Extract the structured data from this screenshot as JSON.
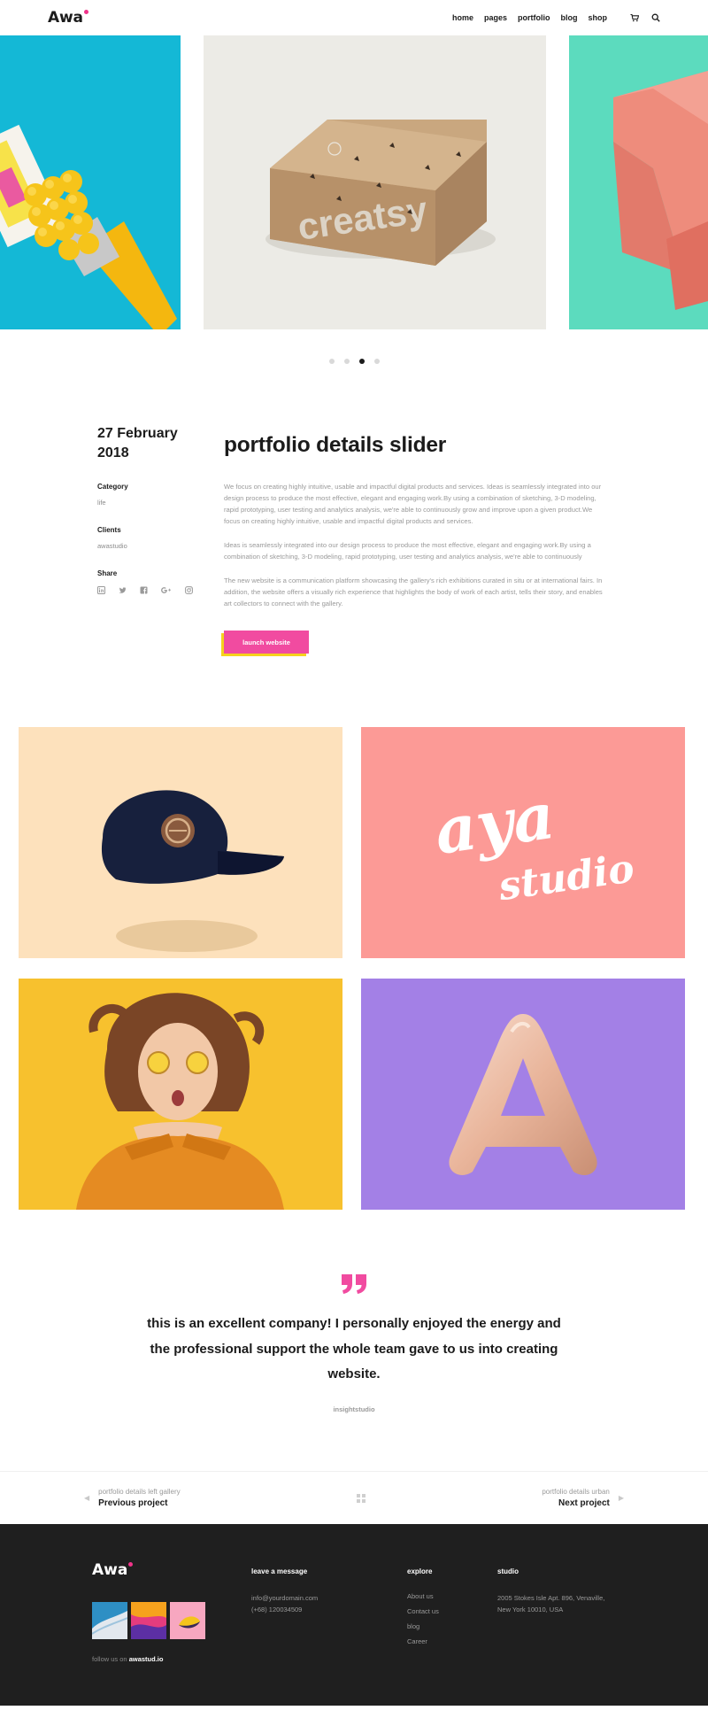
{
  "header": {
    "logo": "Awa",
    "nav": [
      {
        "label": "home",
        "active": false
      },
      {
        "label": "pages",
        "active": false
      },
      {
        "label": "portfolio",
        "active": true
      },
      {
        "label": "blog",
        "active": false
      },
      {
        "label": "shop",
        "active": false
      }
    ]
  },
  "slider": {
    "active_dot": 3,
    "dot_count": 4,
    "center_box_text": "creatsy"
  },
  "details": {
    "date_line1": "27 February",
    "date_line2": "2018",
    "category_label": "Category",
    "category_value": "life",
    "clients_label": "Clients",
    "clients_value": "awastudio",
    "share_label": "Share",
    "title": "portfolio details slider",
    "paragraphs": [
      "We focus on creating highly intuitive, usable and impactful digital products and services. Ideas is seamlessly integrated into our design process to produce the most effective, elegant and engaging work.By using a combination of sketching, 3-D modeling, rapid prototyping, user testing and analytics analysis, we're able to continuously grow and improve upon a given product.We focus on creating highly intuitive, usable and impactful digital products and services.",
      "Ideas is seamlessly integrated into our design process to produce the most effective, elegant and engaging work.By using a combination of sketching, 3-D modeling, rapid prototyping, user testing and analytics analysis, we're able to continuously",
      "The new website is a communication platform showcasing the gallery's rich exhibitions curated in situ or at international fairs. In addition, the website offers a visually rich experience that highlights the body of work of each artist, tells their story, and enables art collectors to connect with the gallery."
    ],
    "launch_label": "launch website"
  },
  "gallery": {
    "aya_line1": "aya",
    "aya_line2": "studio"
  },
  "testimonial": {
    "quote": "this is an excellent company! I personally enjoyed the energy and the professional support the whole team gave to us into creating website.",
    "author": "insightstudio"
  },
  "project_nav": {
    "prev_small": "portfolio details left gallery",
    "prev_big": "Previous project",
    "next_small": "portfolio details urban",
    "next_big": "Next project"
  },
  "footer": {
    "logo": "Awa",
    "follow_prefix": "follow us on",
    "follow_handle": "awastud.io",
    "message_title": "leave a message",
    "email": "info@yourdomain.com",
    "phone": "(+68) 120034509",
    "explore_title": "explore",
    "explore_links": [
      "About us",
      "Contact us",
      "blog",
      "Career"
    ],
    "studio_title": "studio",
    "address_line1": "2005 Stokes Isle Apt. 896, Venaville,",
    "address_line2": "New York 10010, USA"
  },
  "colors": {
    "accent_pink": "#f14ba0",
    "accent_yellow": "#f5d11d"
  }
}
